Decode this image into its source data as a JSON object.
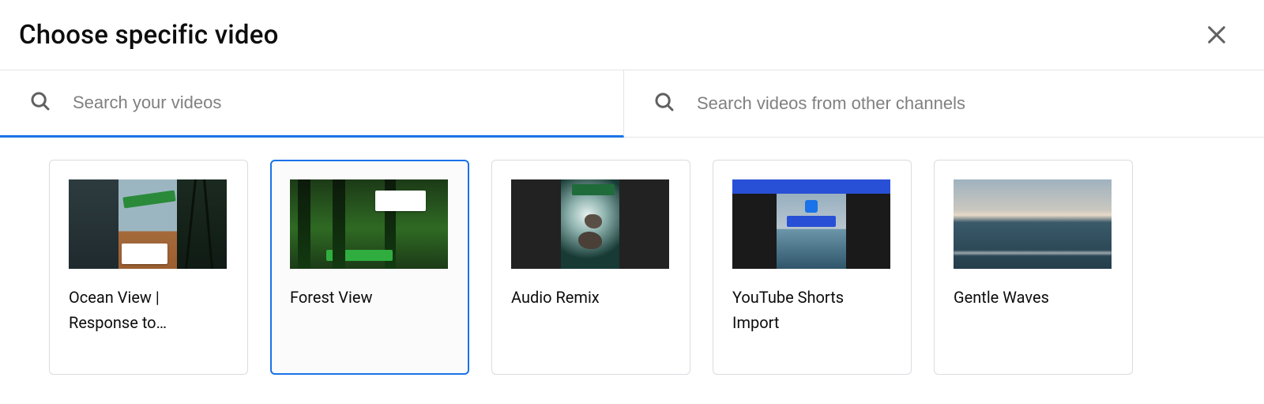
{
  "header": {
    "title": "Choose specific video"
  },
  "search": {
    "your_placeholder": "Search your videos",
    "other_placeholder": "Search videos from other channels"
  },
  "videos": [
    {
      "title": "Ocean View | Response to…",
      "selected": false
    },
    {
      "title": "Forest View",
      "selected": true
    },
    {
      "title": "Audio Remix",
      "selected": false
    },
    {
      "title": "YouTube Shorts Import",
      "selected": false
    },
    {
      "title": "Gentle Waves",
      "selected": false
    }
  ]
}
